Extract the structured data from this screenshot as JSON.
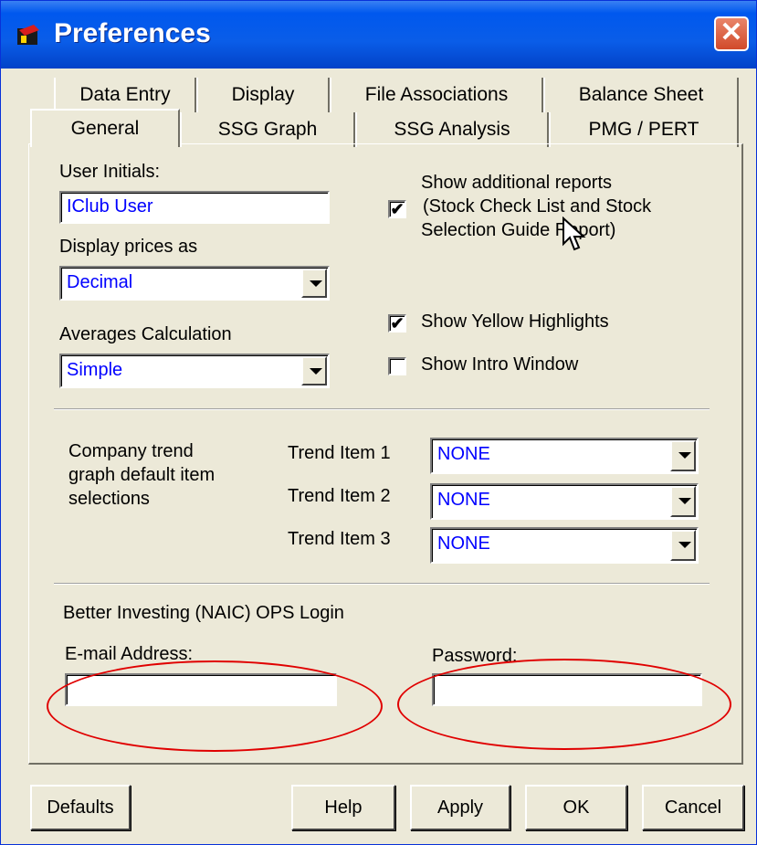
{
  "window": {
    "title": "Preferences",
    "close_glyph": "✕",
    "icon": "app-icon"
  },
  "tabs": {
    "row1": [
      "Data Entry",
      "Display",
      "File Associations",
      "Balance Sheet"
    ],
    "row2": [
      "General",
      "SSG Graph",
      "SSG Analysis",
      "PMG / PERT"
    ],
    "active": "General"
  },
  "general": {
    "user_initials_label": "User Initials:",
    "user_initials_value": "IClub User",
    "display_prices_label": "Display prices as",
    "display_prices_value": "Decimal",
    "averages_label": "Averages Calculation",
    "averages_value": "Simple",
    "show_reports_line1": "Show additional reports",
    "show_reports_line2": "(Stock Check List and Stock",
    "show_reports_line3": "Selection Guide Report)",
    "show_reports_checked": "✔",
    "show_yellow_label": "Show Yellow Highlights",
    "show_yellow_checked": "✔",
    "show_intro_label": "Show Intro Window",
    "show_intro_checked": ""
  },
  "trend": {
    "description_line1": "Company trend",
    "description_line2": "graph default item",
    "description_line3": "selections",
    "items": [
      {
        "label": "Trend Item 1",
        "value": "NONE"
      },
      {
        "label": "Trend Item 2",
        "value": "NONE"
      },
      {
        "label": "Trend Item 3",
        "value": "NONE"
      }
    ]
  },
  "login": {
    "section_label": "Better Investing (NAIC) OPS Login",
    "email_label": "E-mail Address:",
    "email_value": "",
    "password_label": "Password:",
    "password_value": ""
  },
  "buttons": {
    "defaults": "Defaults",
    "help": "Help",
    "apply": "Apply",
    "ok": "OK",
    "cancel": "Cancel"
  },
  "colors": {
    "title_bar": "#0058EE",
    "dialog_bg": "#ECE9D8",
    "field_text": "#0000FF",
    "annotation": "#E00000"
  }
}
